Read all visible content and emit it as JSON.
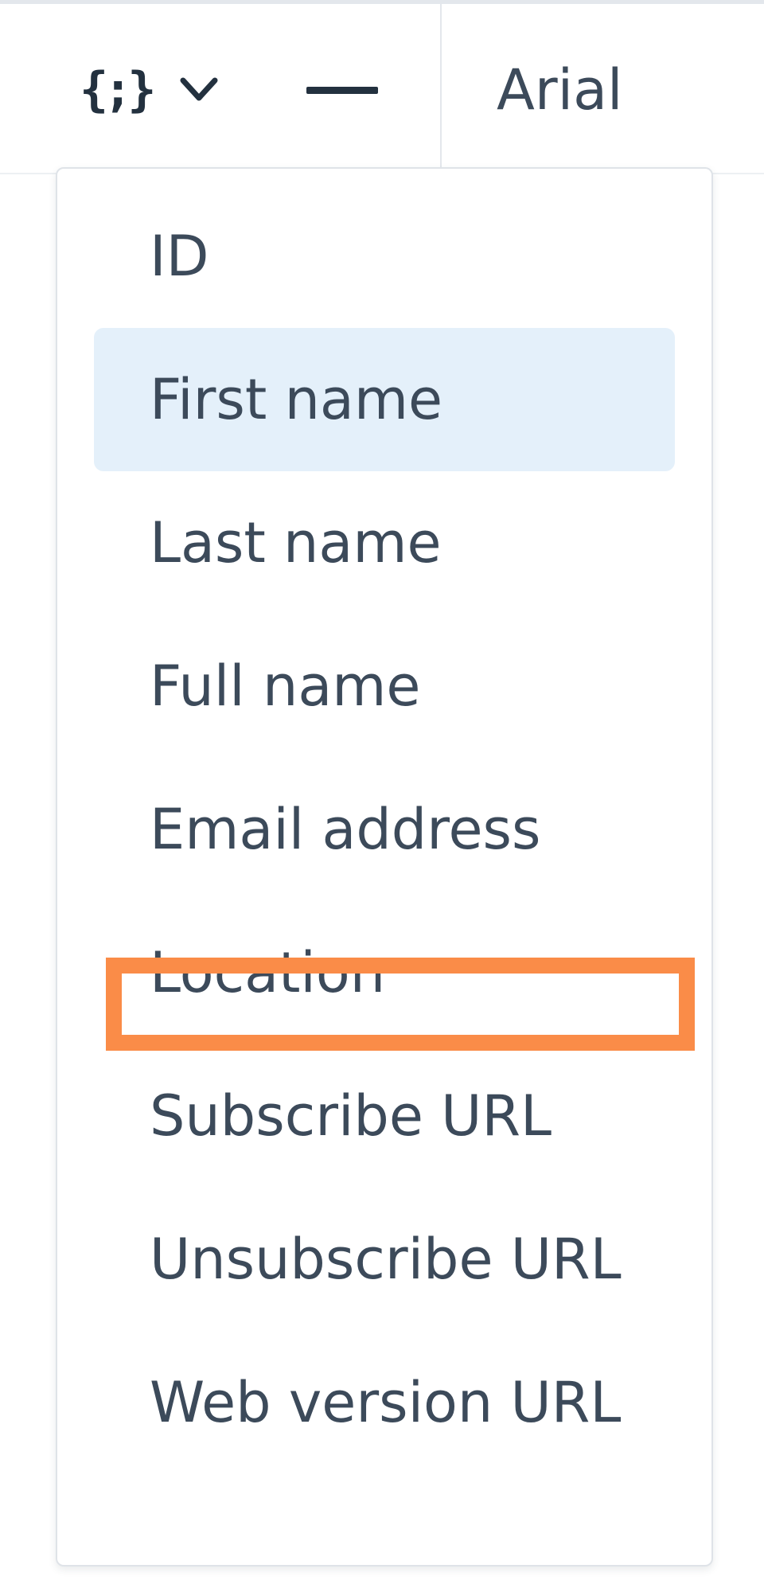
{
  "toolbar": {
    "merge_tags_icon": "{;}",
    "merge_tags_icon_name": "merge-tags-icon",
    "chevron_icon_name": "chevron-down-icon",
    "dash_icon_name": "horizontal-line-icon",
    "font_family_value": "Arial"
  },
  "merge_tags_menu": {
    "items": [
      {
        "label": "ID"
      },
      {
        "label": "First name",
        "highlighted": true
      },
      {
        "label": "Last name"
      },
      {
        "label": "Full name"
      },
      {
        "label": "Email address"
      },
      {
        "label": "Location",
        "focused": true
      },
      {
        "label": "Subscribe URL"
      },
      {
        "label": "Unsubscribe URL"
      },
      {
        "label": "Web version URL"
      }
    ]
  },
  "colors": {
    "highlight_background": "#e4f0fa",
    "focus_outline": "#fa8c48",
    "text": "#3c4a5a",
    "icon": "#23313f"
  }
}
